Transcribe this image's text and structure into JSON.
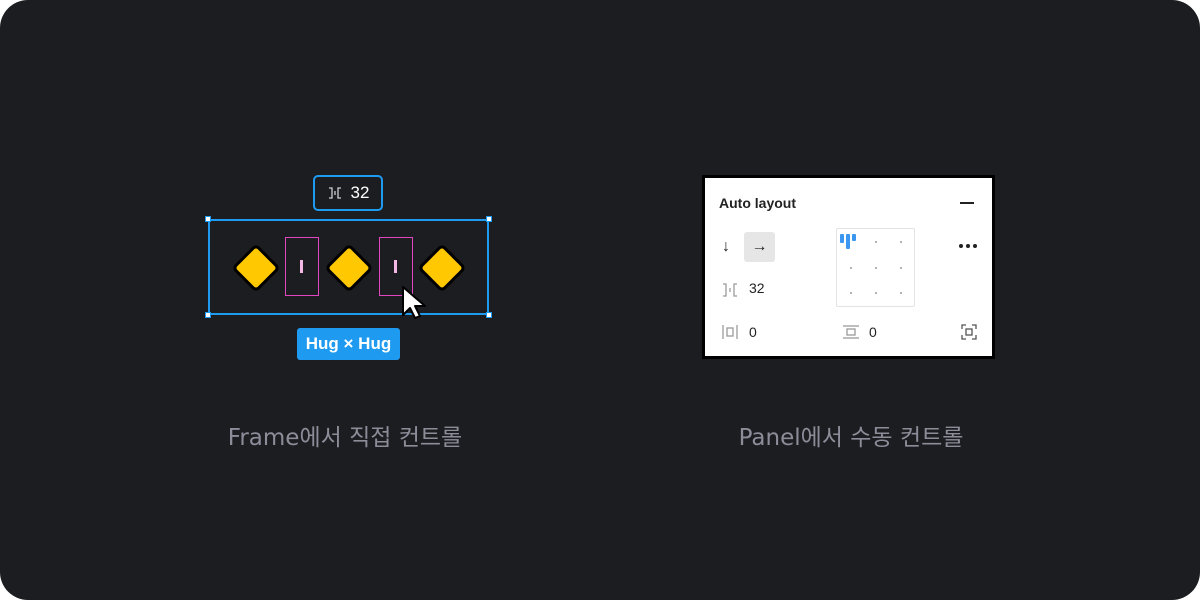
{
  "colors": {
    "background": "#1c1d21",
    "selection": "#1e9bf0",
    "gap_highlight": "#e047c0",
    "diamond_fill": "#ffc800",
    "alignment_active": "#3b97f0"
  },
  "left_demo": {
    "spacing_tooltip": {
      "icon": "item-spacing-icon",
      "value": "32"
    },
    "size_badge": "Hug × Hug",
    "items": [
      "diamond",
      "gap",
      "diamond",
      "gap",
      "diamond"
    ],
    "caption": "Frame에서 직접 컨트롤"
  },
  "panel": {
    "title": "Auto layout",
    "direction_options": [
      "vertical-arrow-icon",
      "horizontal-arrow-icon"
    ],
    "direction_selected": "horizontal",
    "item_spacing": "32",
    "alignment": "top-left",
    "horizontal_padding": "0",
    "vertical_padding": "0"
  },
  "right_caption": "Panel에서 수동 컨트롤"
}
